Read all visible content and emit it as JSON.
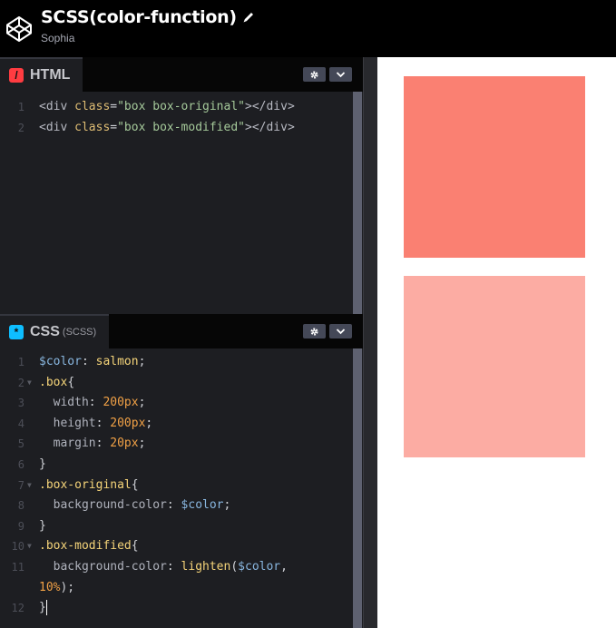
{
  "header": {
    "title": "SCSS(color-function)",
    "author": "Sophia"
  },
  "html_panel": {
    "label": "HTML",
    "icon": "html-icon",
    "icon_glyph": "/",
    "icon_color": "#ff3c41",
    "lines": [
      {
        "n": "1",
        "tokens": [
          [
            "t-tag",
            "<div "
          ],
          [
            "t-attr",
            "class"
          ],
          [
            "t-pun",
            "="
          ],
          [
            "t-str",
            "\"box box-original\""
          ],
          [
            "t-tag",
            "></div>"
          ]
        ]
      },
      {
        "n": "2",
        "tokens": [
          [
            "t-tag",
            "<div "
          ],
          [
            "t-attr",
            "class"
          ],
          [
            "t-pun",
            "="
          ],
          [
            "t-str",
            "\"box box-modified\""
          ],
          [
            "t-tag",
            "></div>"
          ]
        ]
      }
    ]
  },
  "css_panel": {
    "label": "CSS",
    "sublabel": "(SCSS)",
    "icon": "css-icon",
    "icon_glyph": "*",
    "icon_color": "#0ebeff",
    "lines": [
      {
        "n": "1",
        "fold": false,
        "tokens": [
          [
            "t-var",
            "$color"
          ],
          [
            "t-pun",
            ": "
          ],
          [
            "t-sel",
            "salmon"
          ],
          [
            "t-pun",
            ";"
          ]
        ]
      },
      {
        "n": "2",
        "fold": true,
        "tokens": [
          [
            "t-sel",
            ".box"
          ],
          [
            "t-pun",
            "{"
          ]
        ]
      },
      {
        "n": "3",
        "fold": false,
        "tokens": [
          [
            "t-prop",
            "  width"
          ],
          [
            "t-pun",
            ": "
          ],
          [
            "t-num",
            "200px"
          ],
          [
            "t-pun",
            ";"
          ]
        ]
      },
      {
        "n": "4",
        "fold": false,
        "tokens": [
          [
            "t-prop",
            "  height"
          ],
          [
            "t-pun",
            ": "
          ],
          [
            "t-num",
            "200px"
          ],
          [
            "t-pun",
            ";"
          ]
        ]
      },
      {
        "n": "5",
        "fold": false,
        "tokens": [
          [
            "t-prop",
            "  margin"
          ],
          [
            "t-pun",
            ": "
          ],
          [
            "t-num",
            "20px"
          ],
          [
            "t-pun",
            ";"
          ]
        ]
      },
      {
        "n": "6",
        "fold": false,
        "tokens": [
          [
            "t-pun",
            "}"
          ]
        ]
      },
      {
        "n": "7",
        "fold": true,
        "tokens": [
          [
            "t-sel",
            ".box-original"
          ],
          [
            "t-pun",
            "{"
          ]
        ]
      },
      {
        "n": "8",
        "fold": false,
        "tokens": [
          [
            "t-prop",
            "  background-color"
          ],
          [
            "t-pun",
            ": "
          ],
          [
            "t-var",
            "$color"
          ],
          [
            "t-pun",
            ";"
          ]
        ]
      },
      {
        "n": "9",
        "fold": false,
        "tokens": [
          [
            "t-pun",
            "}"
          ]
        ]
      },
      {
        "n": "10",
        "fold": true,
        "tokens": [
          [
            "t-sel",
            ".box-modified"
          ],
          [
            "t-pun",
            "{"
          ]
        ]
      },
      {
        "n": "11",
        "fold": false,
        "tokens": [
          [
            "t-prop",
            "  background-color"
          ],
          [
            "t-pun",
            ": "
          ],
          [
            "t-fn",
            "lighten"
          ],
          [
            "t-pun",
            "("
          ],
          [
            "t-var",
            "$color"
          ],
          [
            "t-pun",
            ","
          ]
        ]
      },
      {
        "n": "",
        "fold": false,
        "tokens": [
          [
            "t-num",
            "10%"
          ],
          [
            "t-pun",
            ");"
          ]
        ]
      },
      {
        "n": "12",
        "fold": false,
        "cursor": true,
        "tokens": [
          [
            "t-pun",
            "}"
          ]
        ]
      }
    ]
  },
  "preview": {
    "boxes": [
      {
        "name": "box-original",
        "color": "#fa8072"
      },
      {
        "name": "box-modified",
        "color": "#fcaca3"
      }
    ]
  },
  "controls": {
    "settings_icon": "gear-icon",
    "collapse_icon": "chevron-down-icon"
  }
}
